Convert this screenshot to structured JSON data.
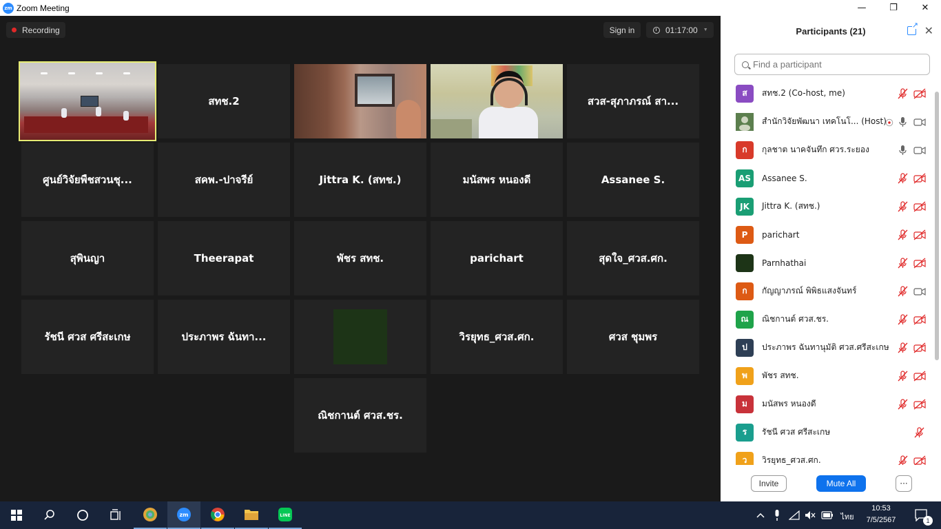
{
  "window": {
    "app_icon_text": "zm",
    "title": "Zoom Meeting",
    "minimize": "—",
    "maximize": "❐",
    "close": "✕"
  },
  "meeting": {
    "recording_label": "Recording",
    "signin_label": "Sign in",
    "timer": "01:17:00"
  },
  "tiles": [
    {
      "name": ""
    },
    {
      "name": "สทช.2"
    },
    {
      "name": ""
    },
    {
      "name": ""
    },
    {
      "name": "สวส-สุภาภรณ์ สา..."
    },
    {
      "name": "ศูนย์วิจัยพืชสวนชุ..."
    },
    {
      "name": "สคพ.-ปาจรีย์"
    },
    {
      "name": "Jittra K. (สทช.)"
    },
    {
      "name": "มนัสพร หนองดี"
    },
    {
      "name": "Assanee S."
    },
    {
      "name": "สุพินญา"
    },
    {
      "name": "Theerapat"
    },
    {
      "name": "พัชร สทช."
    },
    {
      "name": "parichart"
    },
    {
      "name": "สุดใจ_ศวส.ศก."
    },
    {
      "name": "รัชนี ศวส ศรีสะเกษ"
    },
    {
      "name": "ประภาพร  ฉันทา..."
    },
    {
      "name": ""
    },
    {
      "name": "วิรยุทธ_ศวส.ศก."
    },
    {
      "name": "ศวส ชุมพร"
    },
    {
      "name": "ณิชกานต์ ศวส.ชร."
    }
  ],
  "participants_panel": {
    "title": "Participants (21)",
    "search_placeholder": "Find a participant",
    "invite_label": "Invite",
    "mute_all_label": "Mute All",
    "more_label": "···",
    "participants": [
      {
        "initial": "ส",
        "color": "#8a4cc2",
        "name": "สทช.2 (Co-host, me)",
        "mic": "muted",
        "video": "off"
      },
      {
        "initial": "",
        "color": "#3d6b3a",
        "name": "สำนักวิจัยพัฒนา เทคโนโ... (Host)",
        "mic": "on",
        "video": "on",
        "recording": true
      },
      {
        "initial": "ก",
        "color": "#d83a2a",
        "name": "กุลชาต นาคจันทึก ศวร.ระยอง",
        "mic": "on",
        "video": "on"
      },
      {
        "initial": "AS",
        "color": "#1a9e74",
        "name": "Assanee S.",
        "mic": "muted",
        "video": "off"
      },
      {
        "initial": "JK",
        "color": "#1a9e74",
        "name": "Jittra K. (สทช.)",
        "mic": "muted",
        "video": "off"
      },
      {
        "initial": "P",
        "color": "#dd5a14",
        "name": "parichart",
        "mic": "muted",
        "video": "off"
      },
      {
        "initial": "",
        "color": "#1d3417",
        "name": "Parnhathai",
        "mic": "muted",
        "video": "off"
      },
      {
        "initial": "ก",
        "color": "#dd5a14",
        "name": "กัญญาภรณ์ พิพิธแสงจันทร์",
        "mic": "muted",
        "video": "on"
      },
      {
        "initial": "ณ",
        "color": "#1fa34a",
        "name": "ณิชกานต์ ศวส.ชร.",
        "mic": "muted",
        "video": "off"
      },
      {
        "initial": "ป",
        "color": "#2e3f55",
        "name": "ประภาพร  ฉันทานุมัติ ศวส.ศรีสะเกษ",
        "mic": "muted",
        "video": "off"
      },
      {
        "initial": "พ",
        "color": "#f0a11a",
        "name": "พัชร สทช.",
        "mic": "muted",
        "video": "off"
      },
      {
        "initial": "ม",
        "color": "#c8323a",
        "name": "มนัสพร หนองดี",
        "mic": "muted",
        "video": "off"
      },
      {
        "initial": "ร",
        "color": "#1a9e8e",
        "name": "รัชนี ศวส ศรีสะเกษ",
        "mic": "none",
        "video": "muted-only"
      },
      {
        "initial": "ว",
        "color": "#f0a11a",
        "name": "วิรยุทธ_ศวส.ศก.",
        "mic": "muted",
        "video": "off"
      }
    ]
  },
  "taskbar": {
    "time": "10:53",
    "date": "7/5/2567",
    "language": "ไทย",
    "notification_count": "1"
  }
}
